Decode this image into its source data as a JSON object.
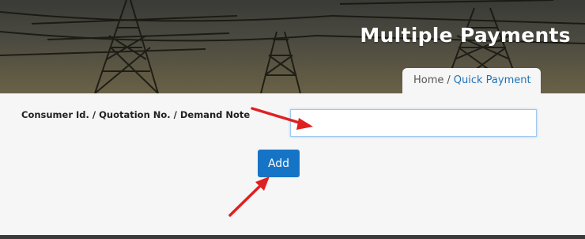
{
  "header": {
    "title": "Multiple Payments"
  },
  "breadcrumb": {
    "home": "Home",
    "separator": "/",
    "current": "Quick Payment"
  },
  "form": {
    "field_label": "Consumer Id. / Quotation No. / Demand Note",
    "field_value": "",
    "add_label": "Add"
  },
  "colors": {
    "accent": "#1674c6",
    "breadcrumb_link": "#1f72b8",
    "annotation_arrow": "#e02020"
  }
}
